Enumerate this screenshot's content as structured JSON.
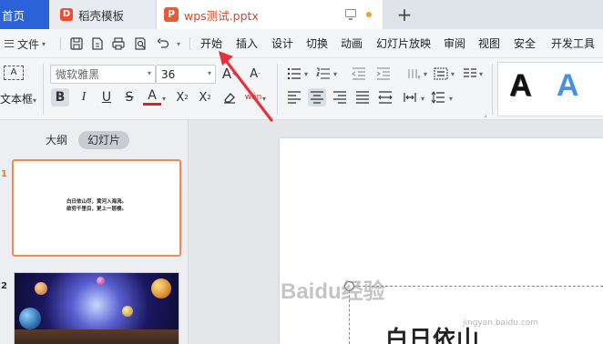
{
  "tabs": {
    "home": "首页",
    "docer": "稻壳模板",
    "docer_logo": "D",
    "file": "wps测试.pptx",
    "file_logo": "P",
    "new_tab": "+"
  },
  "menu": {
    "file": "文件",
    "items": [
      "开始",
      "插入",
      "设计",
      "切换",
      "动画",
      "幻灯片放映",
      "审阅",
      "视图",
      "安全",
      "开发工具"
    ]
  },
  "ribbon": {
    "textbox_label": "文本框",
    "textbox_icon_text": "A",
    "font_name": "微软雅黑",
    "font_size": "36",
    "grow_font": "A",
    "shrink_font": "A",
    "bold": "B",
    "italic": "I",
    "underline": "U",
    "strike": "S",
    "font_color": "A",
    "superscript": "X",
    "subscript": "X",
    "pinyin": "wén",
    "style_black": "A",
    "style_blue": "A"
  },
  "panel": {
    "outline_tab": "大纲",
    "slides_tab": "幻灯片",
    "slide1_num": "1",
    "slide1_line1": "白日依山尽，黄河入海流。",
    "slide1_line2": "欲穷千里目，更上一层楼。",
    "slide2_num": "2"
  },
  "canvas": {
    "title_text": "白日依山"
  },
  "watermark": {
    "text": "Baidu经验",
    "url": "jingyan.baidu.com"
  },
  "colors": {
    "accent_blue": "#2b62d9",
    "ppt_orange": "#ea5a36",
    "selection_orange": "#ee8a52",
    "annotation_red": "#e8303a"
  }
}
